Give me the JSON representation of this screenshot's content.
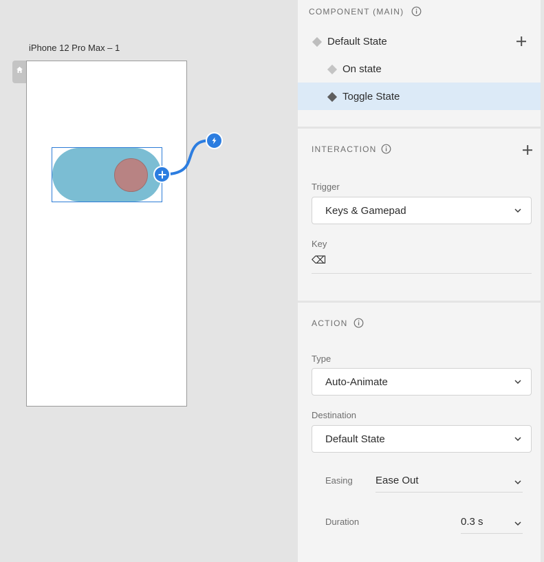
{
  "canvas": {
    "artboard_title": "iPhone 12 Pro Max – 1",
    "track_color": "#7bbdd3",
    "knob_color": "#b88383",
    "wire_color": "#2c7de0"
  },
  "component": {
    "section_title": "COMPONENT (MAIN)",
    "states": [
      {
        "label": "Default State"
      },
      {
        "label": "On state"
      },
      {
        "label": "Toggle State"
      }
    ],
    "selected_state": "Toggle State"
  },
  "interaction": {
    "section_title": "INTERACTION",
    "trigger_label": "Trigger",
    "trigger_value": "Keys & Gamepad",
    "key_label": "Key",
    "key_value": "⌫"
  },
  "action": {
    "section_title": "ACTION",
    "type_label": "Type",
    "type_value": "Auto-Animate",
    "destination_label": "Destination",
    "destination_value": "Default State",
    "easing_label": "Easing",
    "easing_value": "Ease Out",
    "duration_label": "Duration",
    "duration_value": "0.3 s"
  },
  "colors": {
    "accent": "#2c7de0",
    "selected_row": "#dceaf7",
    "panel_bg": "#f4f4f4",
    "canvas_bg": "#e4e4e4"
  }
}
